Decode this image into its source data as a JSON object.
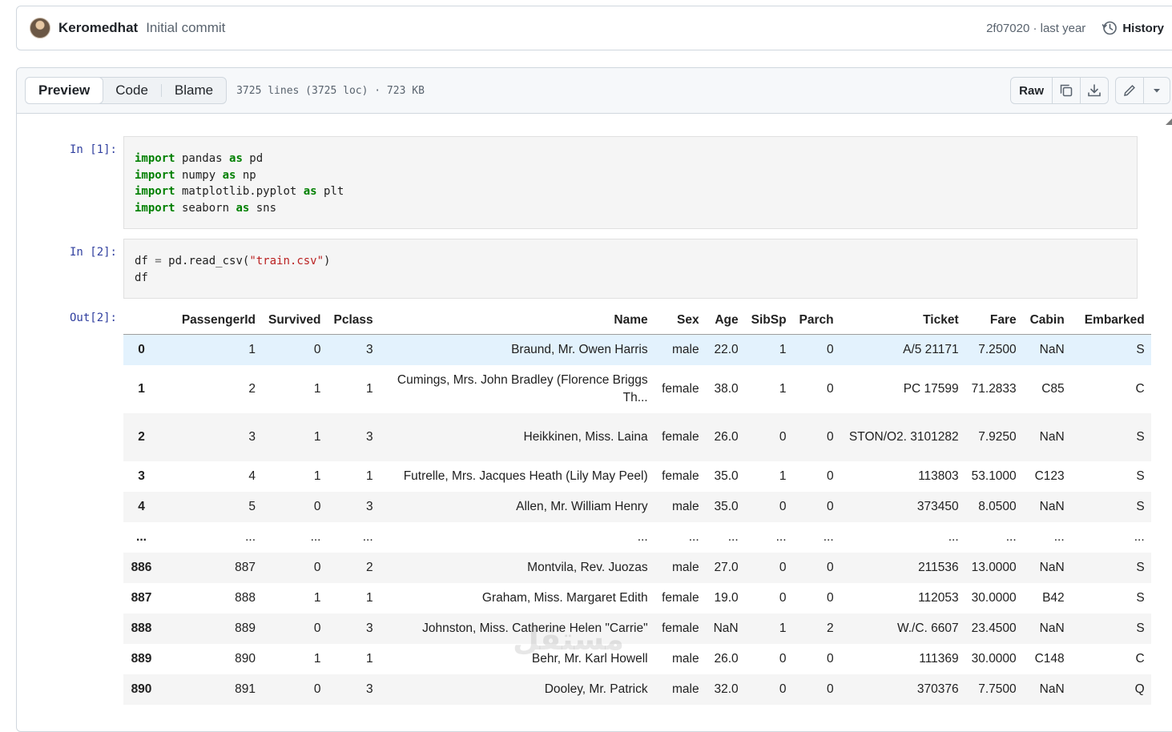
{
  "commit": {
    "author": "Keromedhat",
    "message": "Initial commit",
    "sha_time": "2f07020 · last year",
    "history_label": "History"
  },
  "file_header": {
    "tabs": [
      "Preview",
      "Code",
      "Blame"
    ],
    "active_tab": "Preview",
    "info": "3725 lines (3725 loc) · 723 KB",
    "raw_label": "Raw"
  },
  "cells": [
    {
      "prompt": "In [1]:",
      "lines": [
        [
          [
            "kw",
            "import"
          ],
          [
            "t",
            " pandas "
          ],
          [
            "kw",
            "as"
          ],
          [
            "t",
            " pd"
          ]
        ],
        [
          [
            "kw",
            "import"
          ],
          [
            "t",
            " numpy "
          ],
          [
            "kw",
            "as"
          ],
          [
            "t",
            " np"
          ]
        ],
        [
          [
            "kw",
            "import"
          ],
          [
            "t",
            " matplotlib.pyplot "
          ],
          [
            "kw",
            "as"
          ],
          [
            "t",
            " plt"
          ]
        ],
        [
          [
            "kw",
            "import"
          ],
          [
            "t",
            " seaborn "
          ],
          [
            "kw",
            "as"
          ],
          [
            "t",
            " sns"
          ]
        ]
      ]
    },
    {
      "prompt": "In [2]:",
      "lines": [
        [
          [
            "t",
            "df "
          ],
          [
            "op",
            "="
          ],
          [
            "t",
            " pd.read_csv("
          ],
          [
            "str",
            "\"train.csv\""
          ],
          [
            "t",
            ")"
          ]
        ],
        [
          [
            "t",
            "df"
          ]
        ]
      ]
    }
  ],
  "output": {
    "prompt": "Out[2]:",
    "columns": [
      "",
      "PassengerId",
      "Survived",
      "Pclass",
      "Name",
      "Sex",
      "Age",
      "SibSp",
      "Parch",
      "Ticket",
      "Fare",
      "Cabin",
      "Embarked"
    ],
    "rows": [
      [
        "0",
        "1",
        "0",
        "3",
        "Braund, Mr. Owen Harris",
        "male",
        "22.0",
        "1",
        "0",
        "A/5 21171",
        "7.2500",
        "NaN",
        "S"
      ],
      [
        "1",
        "2",
        "1",
        "1",
        "Cumings, Mrs. John Bradley (Florence Briggs Th...",
        "female",
        "38.0",
        "1",
        "0",
        "PC 17599",
        "71.2833",
        "C85",
        "C"
      ],
      [
        "2",
        "3",
        "1",
        "3",
        "Heikkinen, Miss. Laina",
        "female",
        "26.0",
        "0",
        "0",
        "STON/O2. 3101282",
        "7.9250",
        "NaN",
        "S"
      ],
      [
        "3",
        "4",
        "1",
        "1",
        "Futrelle, Mrs. Jacques Heath (Lily May Peel)",
        "female",
        "35.0",
        "1",
        "0",
        "113803",
        "53.1000",
        "C123",
        "S"
      ],
      [
        "4",
        "5",
        "0",
        "3",
        "Allen, Mr. William Henry",
        "male",
        "35.0",
        "0",
        "0",
        "373450",
        "8.0500",
        "NaN",
        "S"
      ],
      [
        "...",
        "...",
        "...",
        "...",
        "...",
        "...",
        "...",
        "...",
        "...",
        "...",
        "...",
        "...",
        "..."
      ],
      [
        "886",
        "887",
        "0",
        "2",
        "Montvila, Rev. Juozas",
        "male",
        "27.0",
        "0",
        "0",
        "211536",
        "13.0000",
        "NaN",
        "S"
      ],
      [
        "887",
        "888",
        "1",
        "1",
        "Graham, Miss. Margaret Edith",
        "female",
        "19.0",
        "0",
        "0",
        "112053",
        "30.0000",
        "B42",
        "S"
      ],
      [
        "888",
        "889",
        "0",
        "3",
        "Johnston, Miss. Catherine Helen \"Carrie\"",
        "female",
        "NaN",
        "1",
        "2",
        "W./C. 6607",
        "23.4500",
        "NaN",
        "S"
      ],
      [
        "889",
        "890",
        "1",
        "1",
        "Behr, Mr. Karl Howell",
        "male",
        "26.0",
        "0",
        "0",
        "111369",
        "30.0000",
        "C148",
        "C"
      ],
      [
        "890",
        "891",
        "0",
        "3",
        "Dooley, Mr. Patrick",
        "male",
        "32.0",
        "0",
        "0",
        "370376",
        "7.7500",
        "NaN",
        "Q"
      ]
    ],
    "row_heights": [
      38,
      60,
      60,
      38,
      38,
      38,
      38,
      38,
      38,
      38,
      38
    ],
    "hover_row": 0
  },
  "watermark": "مستقل"
}
